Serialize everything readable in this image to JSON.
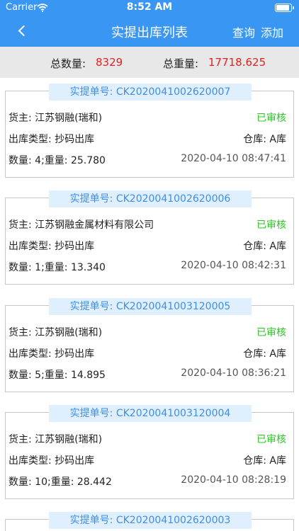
{
  "status_bar": {
    "carrier": "Carrier",
    "time": "8:52 AM"
  },
  "nav": {
    "title": "实提出库列表",
    "query_label": "查询",
    "add_label": "添加"
  },
  "summary": {
    "total_count_label": "总数量:",
    "total_count_value": "8329",
    "total_weight_label": "总重量:",
    "total_weight_value": "17718.625"
  },
  "orders": [
    {
      "tag": "实提单号: CK2020041002620007",
      "owner": "货主: 江苏钢融(瑞和)",
      "status": "已审核",
      "out_type": "出库类型: 抄码出库",
      "warehouse": "仓库: A库",
      "qty_weight": "数量: 4;重量: 25.780",
      "time": "2020-04-10 08:47:41"
    },
    {
      "tag": "实提单号: CK2020041002620006",
      "owner": "货主: 江苏钢融金属材料有限公司",
      "status": "已审核",
      "out_type": "出库类型: 抄码出库",
      "warehouse": "仓库: A库",
      "qty_weight": "数量: 1;重量: 13.340",
      "time": "2020-04-10 08:42:31"
    },
    {
      "tag": "实提单号: CK2020041003120005",
      "owner": "货主: 江苏钢融(瑞和)",
      "status": "已审核",
      "out_type": "出库类型: 抄码出库",
      "warehouse": "仓库: A库",
      "qty_weight": "数量: 5;重量: 14.895",
      "time": "2020-04-10 08:36:21"
    },
    {
      "tag": "实提单号: CK2020041003120004",
      "owner": "货主: 江苏钢融(瑞和)",
      "status": "已审核",
      "out_type": "出库类型: 抄码出库",
      "warehouse": "仓库: A库",
      "qty_weight": "数量: 10;重量: 28.442",
      "time": "2020-04-10 08:28:19"
    },
    {
      "tag": "实提单号: CK2020041002620003"
    }
  ]
}
